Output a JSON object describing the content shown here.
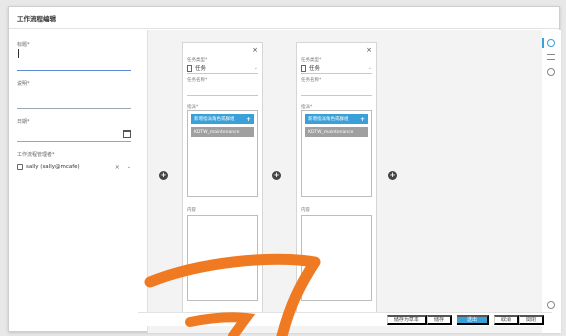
{
  "modal": {
    "title": "工作流程编辑"
  },
  "left": {
    "title_label": "标题*",
    "title_value": "",
    "desc_label": "说明*",
    "date_label": "日期*",
    "assignee_label": "工作流程管理者*",
    "assignee_value": "sally (sally@mcafe)"
  },
  "cards": [
    {
      "task_type_label": "任务类型*",
      "task_type_value": "任务",
      "task_name_label": "任务名称*",
      "assign_label": "指派*",
      "chip_primary": "新增指派角色或群组",
      "chip_secondary": "KDTW_maintenance",
      "content_label": "内容"
    },
    {
      "task_type_label": "任务类型*",
      "task_type_value": "任务",
      "task_name_label": "任务名称*",
      "assign_label": "指派*",
      "chip_primary": "新增指派角色或群组",
      "chip_secondary": "KDTW_maintenance",
      "content_label": "内容"
    }
  ],
  "icons": {
    "close": "×",
    "add": "+",
    "chevron": "⌄",
    "remove": "×"
  },
  "footer": {
    "save_as_draft": "储存为草本",
    "save": "储存",
    "submit": "送出",
    "cancel": "取消",
    "close": "関閉"
  },
  "colors": {
    "accent": "#3aa0d8",
    "chip_gray": "#a0a0a0",
    "annotation_stroke": "#f07a22"
  }
}
